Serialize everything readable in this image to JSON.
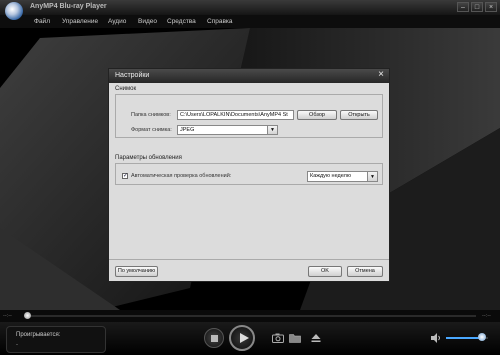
{
  "window": {
    "title": "AnyMP4 Blu-ray Player",
    "controls": [
      "–",
      "□",
      "×"
    ]
  },
  "menu": [
    "Файл",
    "Управление",
    "Аудио",
    "Видео",
    "Средства",
    "Справка"
  ],
  "dialog": {
    "title": "Настройки",
    "close": "×",
    "snapshot": {
      "section": "Снимок",
      "folder_label": "Папка снимков:",
      "folder_value": "C:\\Users\\LOPALKIN\\Documents\\AnyMP4 St",
      "browse": "Обзор",
      "open": "Открыть",
      "format_label": "Формат снимка:",
      "format_value": "JPEG"
    },
    "update": {
      "section": "Параметры обновления",
      "auto_check": "Автоматическая проверка обновлений:",
      "auto_check_checked": true,
      "check_mark": "✓",
      "interval_value": "Каждую неделю"
    },
    "default_button": "По умолчанию",
    "ok_button": "OK",
    "cancel_button": "Отмена"
  },
  "player": {
    "time_left": "--:--",
    "time_right": "--:--",
    "status_label": "Проигрывается:",
    "status_value": "-",
    "volume_level": 0.85
  },
  "icons": {
    "camera": "camera-icon",
    "folder": "folder-icon",
    "eject": "eject-icon",
    "volume": "speaker-icon"
  }
}
